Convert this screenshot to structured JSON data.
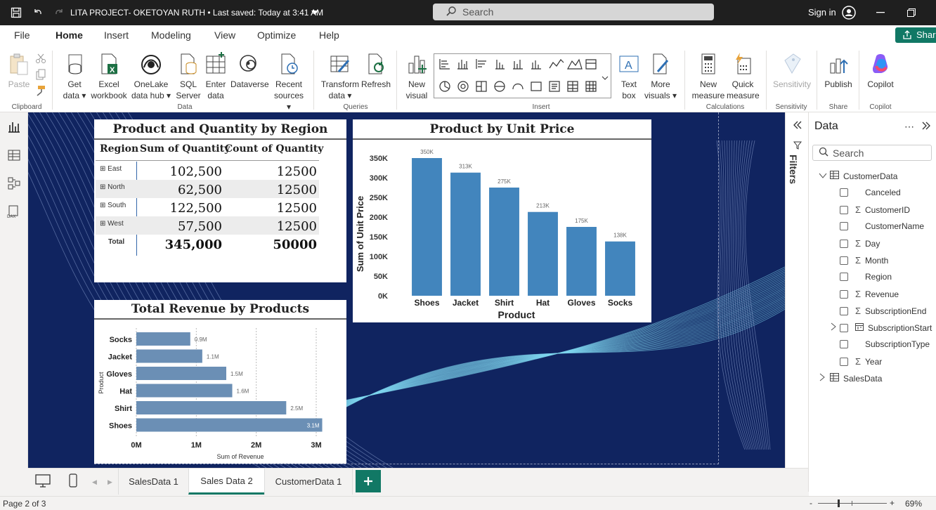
{
  "window": {
    "title": "LITA PROJECT- OKETOYAN RUTH • Last saved: Today at 3:41 AM",
    "search_placeholder": "Search",
    "sign_in": "Sign in"
  },
  "menu": {
    "items": [
      "File",
      "Home",
      "Insert",
      "Modeling",
      "View",
      "Optimize",
      "Help"
    ],
    "active": "Home",
    "share": "Share"
  },
  "ribbon": {
    "paste": "Paste",
    "get_data": "Get data ▾",
    "excel": "Excel workbook",
    "onelake": "OneLake data hub ▾",
    "sql": "SQL Server",
    "enter_data": "Enter data",
    "dataverse": "Dataverse",
    "recent": "Recent sources ▾",
    "transform": "Transform data ▾",
    "refresh": "Refresh",
    "new_visual": "New visual",
    "text_box": "Text box",
    "more_visuals": "More visuals ▾",
    "new_measure": "New measure",
    "quick_measure": "Quick measure",
    "sensitivity": "Sensitivity",
    "publish": "Publish",
    "copilot": "Copilot",
    "groups": {
      "clipboard": "Clipboard",
      "data": "Data",
      "queries": "Queries",
      "insert": "Insert",
      "calculations": "Calculations",
      "sensitivity": "Sensitivity",
      "share": "Share",
      "copilot": "Copilot"
    }
  },
  "matrix": {
    "title": "Product and Quantity by Region",
    "headers": [
      "Region",
      "Sum of Quantity",
      "Count of Quantity"
    ],
    "rows": [
      {
        "region": "East",
        "sum": "102,500",
        "count": "12500"
      },
      {
        "region": "North",
        "sum": "62,500",
        "count": "12500"
      },
      {
        "region": "South",
        "sum": "122,500",
        "count": "12500"
      },
      {
        "region": "West",
        "sum": "57,500",
        "count": "12500"
      }
    ],
    "total": {
      "region": "Total",
      "sum": "345,000",
      "count": "50000"
    }
  },
  "chart_data": [
    {
      "type": "bar",
      "title": "Product by Unit Price",
      "categories": [
        "Shoes",
        "Jacket",
        "Shirt",
        "Hat",
        "Gloves",
        "Socks"
      ],
      "values": [
        350000,
        313000,
        275000,
        213000,
        175000,
        138000
      ],
      "data_labels": [
        "350K",
        "313K",
        "275K",
        "213K",
        "175K",
        "138K"
      ],
      "xlabel": "Product",
      "ylabel": "Sum of Unit Price",
      "ylim": [
        0,
        350000
      ],
      "yticks": [
        "0K",
        "50K",
        "100K",
        "150K",
        "200K",
        "250K",
        "300K",
        "350K"
      ],
      "color": "#4285bd"
    },
    {
      "type": "bar",
      "orientation": "horizontal",
      "title": "Total Revenue by Products",
      "categories": [
        "Socks",
        "Jacket",
        "Gloves",
        "Hat",
        "Shirt",
        "Shoes"
      ],
      "values": [
        0.9,
        1.1,
        1.5,
        1.6,
        2.5,
        3.1
      ],
      "data_labels": [
        "0.9M",
        "1.1M",
        "1.5M",
        "1.6M",
        "2.5M",
        "3.1M"
      ],
      "xlabel": "Sum of Revenue",
      "ylabel": "Product",
      "xlim": [
        0,
        3
      ],
      "xticks": [
        "0M",
        "1M",
        "2M",
        "3M"
      ],
      "color": "#6b8fb5"
    }
  ],
  "data_pane": {
    "title": "Data",
    "filters_label": "Filters",
    "search_placeholder": "Search",
    "tables": [
      {
        "name": "CustomerData",
        "expanded": true,
        "fields": [
          {
            "name": "Canceled",
            "sigma": false
          },
          {
            "name": "CustomerID",
            "sigma": true
          },
          {
            "name": "CustomerName",
            "sigma": false
          },
          {
            "name": "Day",
            "sigma": true
          },
          {
            "name": "Month",
            "sigma": true
          },
          {
            "name": "Region",
            "sigma": false
          },
          {
            "name": "Revenue",
            "sigma": true
          },
          {
            "name": "SubscriptionEnd",
            "sigma": true
          },
          {
            "name": "SubscriptionStart",
            "sigma": false,
            "hierarchy": true
          },
          {
            "name": "SubscriptionType",
            "sigma": false
          },
          {
            "name": "Year",
            "sigma": true
          }
        ]
      },
      {
        "name": "SalesData",
        "expanded": false
      }
    ]
  },
  "tabs": {
    "pages": [
      "SalesData 1",
      "Sales Data 2",
      "CustomerData 1"
    ],
    "active": "Sales Data 2"
  },
  "status": {
    "page": "Page 2 of 3",
    "zoom": "69%",
    "minus": "-",
    "plus": "+"
  }
}
